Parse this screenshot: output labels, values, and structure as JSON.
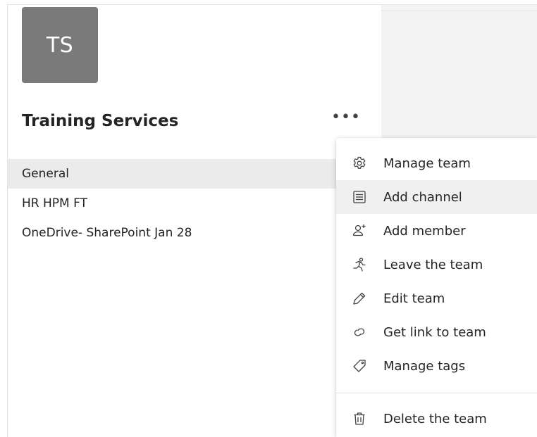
{
  "team": {
    "initials": "TS",
    "name": "Training Services",
    "more_icon": "ellipsis-icon",
    "more_label": "•••"
  },
  "channels": [
    {
      "label": "General",
      "active": true
    },
    {
      "label": "HR HPM FT",
      "active": false
    },
    {
      "label": "OneDrive- SharePoint Jan 28",
      "active": false
    }
  ],
  "context_menu": {
    "items": [
      {
        "label": "Manage team",
        "icon": "gear-icon"
      },
      {
        "label": "Add channel",
        "icon": "channel-list-icon",
        "highlighted": true
      },
      {
        "label": "Add member",
        "icon": "add-person-icon"
      },
      {
        "label": "Leave the team",
        "icon": "running-person-icon"
      },
      {
        "label": "Edit team",
        "icon": "pencil-icon"
      },
      {
        "label": "Get link to team",
        "icon": "link-icon"
      },
      {
        "label": "Manage tags",
        "icon": "tag-icon"
      },
      {
        "label": "Delete the team",
        "icon": "trash-icon"
      }
    ]
  },
  "colors": {
    "avatar_bg": "#7a7a7a",
    "active_channel_bg": "#ebebeb",
    "menu_highlight_bg": "#f0f0f0",
    "right_pane_bg": "#f3f3f3"
  }
}
